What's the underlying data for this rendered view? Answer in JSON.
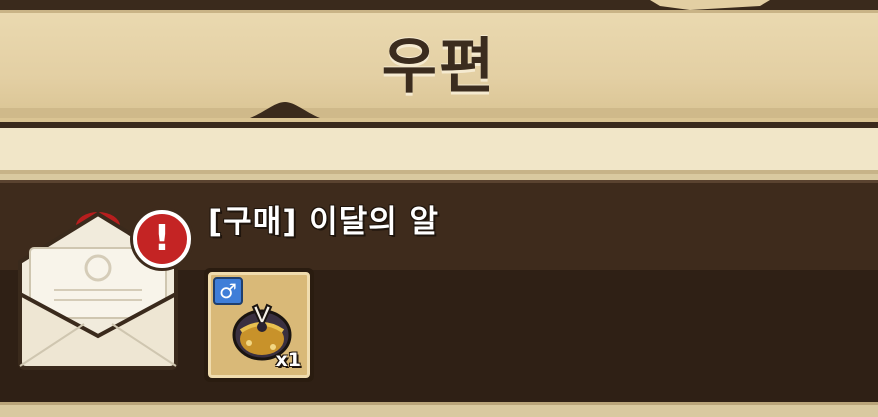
{
  "header": {
    "title": "우편"
  },
  "mail_items": [
    {
      "title": "[구매] 이달의 알",
      "alert_symbol": "!",
      "icon": "envelope-icon",
      "reward": {
        "icon": "egg-icon",
        "gender_symbol": "♂",
        "quantity": "x1"
      }
    }
  ],
  "colors": {
    "banner": "#e3cfa3",
    "row_background": "#3e2b1c",
    "alert_red": "#c42424",
    "gender_blue": "#3f7ed8",
    "slot_gold": "#d9b978"
  }
}
